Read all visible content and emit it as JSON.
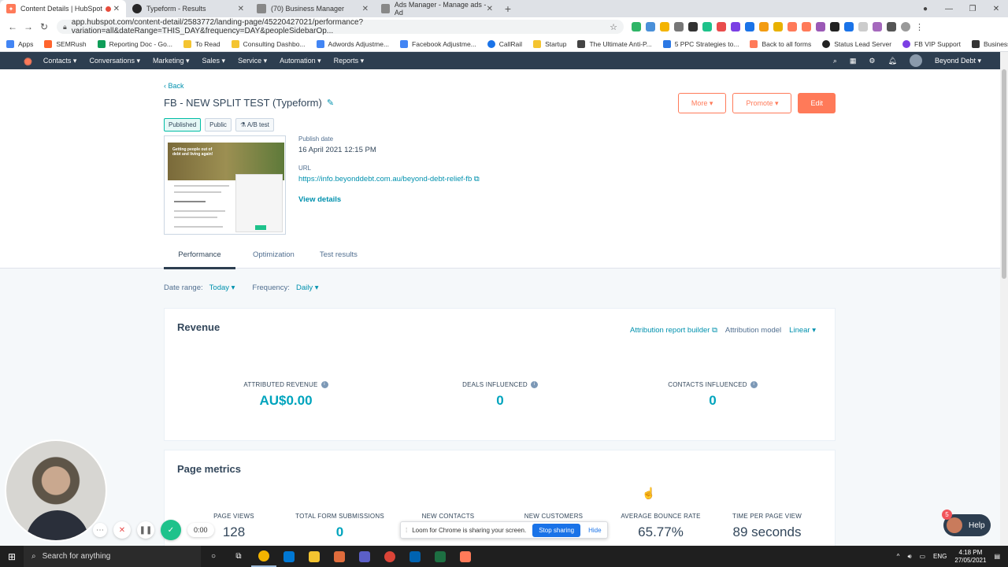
{
  "browser": {
    "tabs": [
      {
        "title": "Content Details | HubSpot",
        "active": true,
        "favicon_color": "#ff7a59"
      },
      {
        "title": "Typeform - Results",
        "active": false,
        "favicon_color": "#262627"
      },
      {
        "title": "(70) Business Manager",
        "active": false,
        "favicon_color": "#6c757d"
      },
      {
        "title": "Ads Manager - Manage ads - Ad",
        "active": false,
        "favicon_color": "#6c757d"
      }
    ],
    "new_tab_symbol": "+",
    "url": "app.hubspot.com/content-detail/2583772/landing-page/45220427021/performance?variation=all&dateRange=THIS_DAY&frequency=DAY&peopleSidebarOp...",
    "bookmarks": [
      "Apps",
      "SEMRush",
      "Reporting Doc - Go...",
      "To Read",
      "Consulting Dashbo...",
      "Adwords Adjustme...",
      "Facebook Adjustme...",
      "CallRail",
      "Startup",
      "The Ultimate Anti-P...",
      "5 PPC Strategies to...",
      "Back to all forms",
      "Status Lead Server",
      "FB VIP Support",
      "Business Manager"
    ]
  },
  "hubspot_nav": {
    "items": [
      "Contacts ▾",
      "Conversations ▾",
      "Marketing ▾",
      "Sales ▾",
      "Service ▾",
      "Automation ▾",
      "Reports ▾"
    ],
    "account": "Beyond Debt ▾"
  },
  "header": {
    "back": "‹  Back",
    "title": "FB - NEW SPLIT TEST (Typeform)",
    "badges": [
      "Published",
      "Public",
      "A/B test"
    ],
    "buttons": {
      "more": "More ▾",
      "promote": "Promote ▾",
      "edit": "Edit"
    }
  },
  "thumbnail": {
    "hero_text": "Getting people out of debt and living again!"
  },
  "details": {
    "publish_date_label": "Publish date",
    "publish_date": "16 April 2021 12:15 PM",
    "url_label": "URL",
    "url": "https://info.beyonddebt.com.au/beyond-debt-relief-fb",
    "view_details": "View details"
  },
  "page_tabs": [
    "Performance",
    "Optimization",
    "Test results"
  ],
  "filters": {
    "date_range_label": "Date range:",
    "date_range": "Today ▾",
    "frequency_label": "Frequency:",
    "frequency": "Daily ▾"
  },
  "revenue": {
    "title": "Revenue",
    "attribution_builder": "Attribution report builder",
    "attribution_model_label": "Attribution model",
    "attribution_model": "Linear ▾",
    "kpis": [
      {
        "label": "ATTRIBUTED REVENUE",
        "value": "AU$0.00"
      },
      {
        "label": "DEALS INFLUENCED",
        "value": "0"
      },
      {
        "label": "CONTACTS INFLUENCED",
        "value": "0"
      }
    ]
  },
  "metrics": {
    "title": "Page metrics",
    "kpis": [
      {
        "label": "PAGE VIEWS",
        "value": "128"
      },
      {
        "label": "TOTAL FORM SUBMISSIONS",
        "value": "0"
      },
      {
        "label": "NEW CONTACTS",
        "value": ""
      },
      {
        "label": "NEW CUSTOMERS",
        "value": ""
      },
      {
        "label": "AVERAGE BOUNCE RATE",
        "value": "65.77%"
      },
      {
        "label": "TIME PER PAGE VIEW",
        "value": "89 seconds"
      }
    ]
  },
  "loom": {
    "timer": "0:00",
    "share_message": "Loom for Chrome is sharing your screen.",
    "stop_sharing": "Stop sharing",
    "hide": "Hide"
  },
  "help_widget": {
    "label": "Help",
    "count": "5"
  },
  "taskbar": {
    "search_placeholder": "Search for anything",
    "language": "ENG",
    "time": "4:18 PM",
    "date": "27/05/2021"
  },
  "colors": {
    "accent": "#ff7a59",
    "link": "#0091ae",
    "nav_bg": "#2d3e50",
    "kpi": "#00a4bd"
  }
}
